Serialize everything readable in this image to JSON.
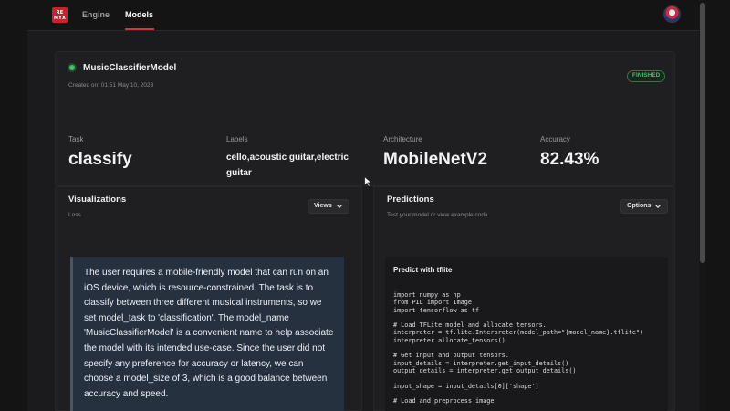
{
  "nav": {
    "logo_line1": "RE",
    "logo_line2": "MYX",
    "tabs": [
      {
        "label": "Engine"
      },
      {
        "label": "Models"
      }
    ],
    "active_tab": "Models"
  },
  "model": {
    "name": "MusicClassifierModel",
    "created": "Created on: 01:51 May 10, 2023",
    "status": "FINISHED",
    "stats": [
      {
        "label": "Task",
        "value": "classify"
      },
      {
        "label": "Labels",
        "value": "cello,acoustic guitar,electric guitar"
      },
      {
        "label": "Architecture",
        "value": "MobileNetV2"
      },
      {
        "label": "Accuracy",
        "value": "82.43%"
      }
    ]
  },
  "visualizations": {
    "title": "Visualizations",
    "subtitle": "Loss",
    "button_label": "Views",
    "reasoning": "The user requires a mobile-friendly model that can run on an iOS device, which is resource-constrained. The task is to classify between three different musical instruments, so we set model_task to 'classification'. The model_name 'MusicClassifierModel' is a convenient name to help associate the model with its intended use-case. Since the user did not specify any preference for accuracy or latency, we can choose a model_size of 3, which is a good balance between accuracy and speed."
  },
  "predictions": {
    "title": "Predictions",
    "subtitle": "Test your model or view example code",
    "button_label": "Options",
    "code_title": "Predict with tflite",
    "code_lines": [
      "import numpy as np",
      "from PIL import Image",
      "import tensorflow as tf",
      "",
      "# Load TFLite model and allocate tensors.",
      "interpreter = tf.lite.Interpreter(model_path=\"{model_name}.tflite\")",
      "interpreter.allocate_tensors()",
      "",
      "# Get input and output tensors.",
      "input_details = interpreter.get_input_details()",
      "output_details = interpreter.get_output_details()",
      "",
      "input_shape = input_details[0]['shape']",
      "",
      "# Load and preprocess image"
    ]
  },
  "colors": {
    "accent": "#d4343c",
    "status_green": "#44c774",
    "reasoning_bg": "#263140"
  }
}
